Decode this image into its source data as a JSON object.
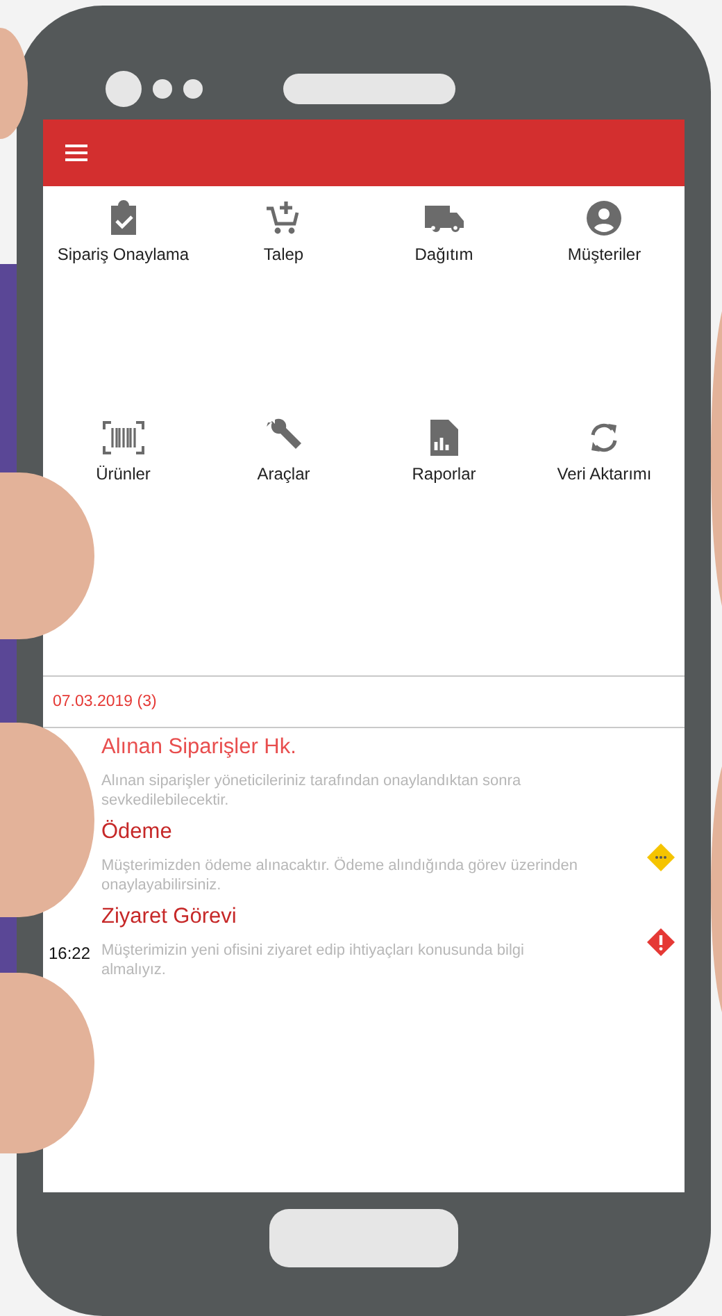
{
  "menu": [
    {
      "label": "Sipariş Onaylama"
    },
    {
      "label": "Talep"
    },
    {
      "label": "Dağıtım"
    },
    {
      "label": "Müşteriler"
    },
    {
      "label": "Ürünler"
    },
    {
      "label": "Araçlar"
    },
    {
      "label": "Raporlar"
    },
    {
      "label": "Veri Aktarımı"
    }
  ],
  "date_header": "07.03.2019 (3)",
  "tasks": [
    {
      "title": "Alınan Siparişler Hk.",
      "color": "#e84e4e",
      "description": "Alınan siparişler yöneticileriniz tarafından onaylandıktan sonra sevkedilebilecektir.",
      "kind": "plain"
    },
    {
      "title": "Ödeme",
      "color": "#c62828",
      "description": "Müşterimizden ödeme alınacaktır. Ödeme alındığında görev üzerinden onaylayabilirsiniz.",
      "kind": "pending"
    },
    {
      "title": "Ziyaret Görevi",
      "color": "#c62828",
      "time": "16:22",
      "description": "Müşterimizin yeni ofisini ziyaret edip ihtiyaçları konusunda bilgi almalıyız.",
      "kind": "alert"
    }
  ]
}
